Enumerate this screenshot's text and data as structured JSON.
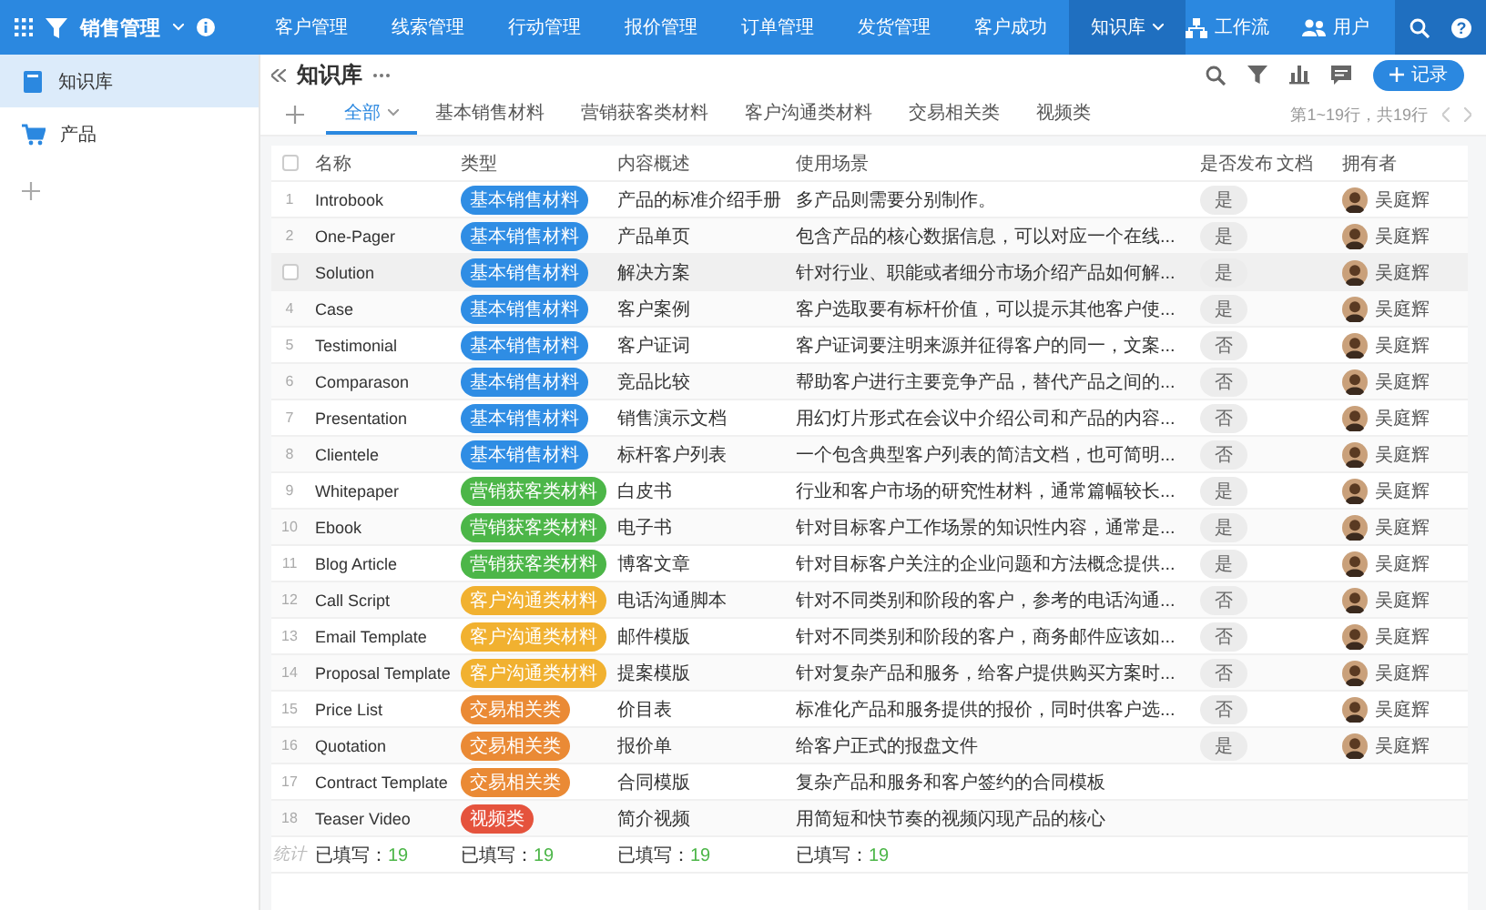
{
  "app": {
    "title": "销售管理"
  },
  "nav": [
    {
      "label": "客户管理",
      "selected": false
    },
    {
      "label": "线索管理",
      "selected": false
    },
    {
      "label": "行动管理",
      "selected": false
    },
    {
      "label": "报价管理",
      "selected": false
    },
    {
      "label": "订单管理",
      "selected": false
    },
    {
      "label": "发货管理",
      "selected": false
    },
    {
      "label": "客户成功",
      "selected": false
    },
    {
      "label": "知识库",
      "selected": true
    }
  ],
  "help_icon": "?",
  "nav_right": [
    {
      "label": "工作流",
      "kind": "workflow"
    },
    {
      "label": "用户",
      "kind": "users"
    }
  ],
  "sidebar": {
    "items": [
      {
        "label": "知识库",
        "kind": "book",
        "selected": true
      },
      {
        "label": "产品",
        "kind": "cart",
        "selected": false
      }
    ]
  },
  "page": {
    "title": "知识库",
    "add_button": "记录"
  },
  "tabs": [
    {
      "label": "全部",
      "selected": true
    },
    {
      "label": "基本销售材料",
      "selected": false
    },
    {
      "label": "营销获客类材料",
      "selected": false
    },
    {
      "label": "客户沟通类材料",
      "selected": false
    },
    {
      "label": "交易相关类",
      "selected": false
    },
    {
      "label": "视频类",
      "selected": false
    }
  ],
  "pagination": "第1~19行，共19行",
  "table": {
    "select_all_checked": false,
    "columns": [
      "名称",
      "类型",
      "内容概述",
      "使用场景",
      "是否发布",
      "文档",
      "拥有者"
    ],
    "rows": [
      {
        "index": "1",
        "hovered": false,
        "checked": false,
        "name": "Introbook",
        "type": {
          "label": "基本销售材料",
          "color": "#2f8de4"
        },
        "summary": "产品的标准介绍手册",
        "usage": "多产品则需要分别制作。",
        "published": "是",
        "owner": "吴庭辉"
      },
      {
        "index": "2",
        "hovered": false,
        "checked": false,
        "name": "One-Pager",
        "type": {
          "label": "基本销售材料",
          "color": "#2f8de4"
        },
        "summary": "产品单页",
        "usage": "包含产品的核心数据信息，可以对应一个在线...",
        "published": "是",
        "owner": "吴庭辉"
      },
      {
        "hovered": true,
        "checked": false,
        "name": "Solution",
        "type": {
          "label": "基本销售材料",
          "color": "#2f8de4"
        },
        "summary": "解决方案",
        "usage": "针对行业、职能或者细分市场介绍产品如何解...",
        "published": "是",
        "owner": "吴庭辉"
      },
      {
        "index": "4",
        "hovered": false,
        "checked": false,
        "name": "Case",
        "type": {
          "label": "基本销售材料",
          "color": "#2f8de4"
        },
        "summary": "客户案例",
        "usage": "客户选取要有标杆价值，可以提示其他客户使...",
        "published": "是",
        "owner": "吴庭辉"
      },
      {
        "index": "5",
        "hovered": false,
        "checked": false,
        "name": "Testimonial",
        "type": {
          "label": "基本销售材料",
          "color": "#2f8de4"
        },
        "summary": "客户证词",
        "usage": "客户证词要注明来源并征得客户的同一，文案...",
        "published": "否",
        "owner": "吴庭辉"
      },
      {
        "index": "6",
        "hovered": false,
        "checked": false,
        "name": "Comparason",
        "type": {
          "label": "基本销售材料",
          "color": "#2f8de4"
        },
        "summary": "竞品比较",
        "usage": "帮助客户进行主要竞争产品，替代产品之间的...",
        "published": "否",
        "owner": "吴庭辉"
      },
      {
        "index": "7",
        "hovered": false,
        "checked": false,
        "name": "Presentation",
        "type": {
          "label": "基本销售材料",
          "color": "#2f8de4"
        },
        "summary": "销售演示文档",
        "usage": "用幻灯片形式在会议中介绍公司和产品的内容...",
        "published": "否",
        "owner": "吴庭辉"
      },
      {
        "index": "8",
        "hovered": false,
        "checked": false,
        "name": "Clientele",
        "type": {
          "label": "基本销售材料",
          "color": "#2f8de4"
        },
        "summary": "标杆客户列表",
        "usage": "一个包含典型客户列表的简洁文档，也可简明...",
        "published": "否",
        "owner": "吴庭辉"
      },
      {
        "index": "9",
        "hovered": false,
        "checked": false,
        "name": "Whitepaper",
        "type": {
          "label": "营销获客类材料",
          "color": "#4cb648"
        },
        "summary": "白皮书",
        "usage": "行业和客户市场的研究性材料，通常篇幅较长...",
        "published": "是",
        "owner": "吴庭辉"
      },
      {
        "index": "10",
        "hovered": false,
        "checked": false,
        "name": "Ebook",
        "type": {
          "label": "营销获客类材料",
          "color": "#4cb648"
        },
        "summary": "电子书",
        "usage": "针对目标客户工作场景的知识性内容，通常是...",
        "published": "是",
        "owner": "吴庭辉"
      },
      {
        "index": "11",
        "hovered": false,
        "checked": false,
        "name": "Blog Article",
        "type": {
          "label": "营销获客类材料",
          "color": "#4cb648"
        },
        "summary": "博客文章",
        "usage": "针对目标客户关注的企业问题和方法概念提供...",
        "published": "是",
        "owner": "吴庭辉"
      },
      {
        "index": "12",
        "hovered": false,
        "checked": false,
        "name": "Call Script",
        "type": {
          "label": "客户沟通类材料",
          "color": "#f1b130"
        },
        "summary": "电话沟通脚本",
        "usage": "针对不同类别和阶段的客户，参考的电话沟通...",
        "published": "否",
        "owner": "吴庭辉"
      },
      {
        "index": "13",
        "hovered": false,
        "checked": false,
        "name": "Email Template",
        "type": {
          "label": "客户沟通类材料",
          "color": "#f1b130"
        },
        "summary": "邮件模版",
        "usage": "针对不同类别和阶段的客户，商务邮件应该如...",
        "published": "否",
        "owner": "吴庭辉"
      },
      {
        "index": "14",
        "hovered": false,
        "checked": false,
        "name": "Proposal Template",
        "type": {
          "label": "客户沟通类材料",
          "color": "#f1b130"
        },
        "summary": "提案模版",
        "usage": "针对复杂产品和服务，给客户提供购买方案时...",
        "published": "否",
        "owner": "吴庭辉"
      },
      {
        "index": "15",
        "hovered": false,
        "checked": false,
        "name": "Price List",
        "type": {
          "label": "交易相关类",
          "color": "#ea8a35"
        },
        "summary": "价目表",
        "usage": "标准化产品和服务提供的报价，同时供客户选...",
        "published": "否",
        "owner": "吴庭辉"
      },
      {
        "index": "16",
        "hovered": false,
        "checked": false,
        "name": "Quotation",
        "type": {
          "label": "交易相关类",
          "color": "#ea8a35"
        },
        "summary": "报价单",
        "usage": "给客户正式的报盘文件",
        "published": "是",
        "owner": "吴庭辉"
      },
      {
        "index": "17",
        "hovered": false,
        "checked": false,
        "name": "Contract Template",
        "type": {
          "label": "交易相关类",
          "color": "#ea8a35"
        },
        "summary": "合同模版",
        "usage": "复杂产品和服务和客户签约的合同模板"
      },
      {
        "index": "18",
        "hovered": false,
        "checked": false,
        "name": "Teaser Video",
        "type": {
          "label": "视频类",
          "color": "#e5533d"
        },
        "summary": "简介视频",
        "usage": "用简短和快节奏的视频闪现产品的核心"
      }
    ],
    "footer": {
      "label": "统计",
      "cells": [
        {
          "label": "已填写：",
          "count": "19"
        },
        {
          "label": "已填写：",
          "count": "19"
        },
        {
          "label": "已填写：",
          "count": "19"
        },
        {
          "label": "已填写：",
          "count": "19"
        }
      ]
    }
  }
}
